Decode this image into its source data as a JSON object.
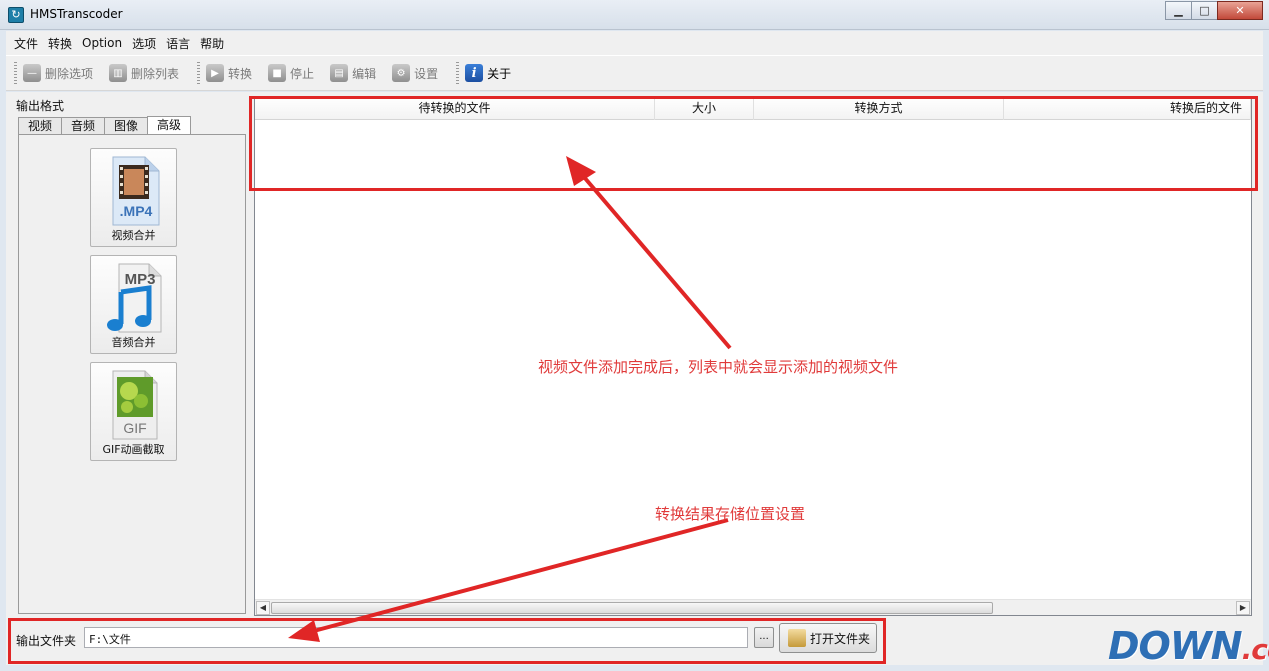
{
  "window": {
    "title": "HMSTranscoder",
    "minimize": "▁",
    "maximize": "□",
    "close": "✕"
  },
  "menu": [
    "文件",
    "转换",
    "Option",
    "选项",
    "语言",
    "帮助"
  ],
  "toolbar": {
    "delete_option": "删除选项",
    "delete_list": "删除列表",
    "convert": "转换",
    "stop": "停止",
    "edit": "编辑",
    "settings": "设置",
    "about": "关于"
  },
  "left": {
    "format_label": "输出格式",
    "tabs": [
      "视频",
      "音频",
      "图像",
      "高级"
    ],
    "selected_tab": "高级",
    "items": [
      {
        "label": "视频合并",
        "thumb": ".MP4"
      },
      {
        "label": "音频合并",
        "thumb": "MP3"
      },
      {
        "label": "GIF动画截取",
        "thumb": "GIF"
      }
    ]
  },
  "list": {
    "columns": [
      "待转换的文件",
      "大小",
      "转换方式",
      "转换后的文件"
    ]
  },
  "output": {
    "label": "输出文件夹",
    "path": "F:\\文件",
    "browse": "...",
    "open_folder": "打开文件夹"
  },
  "annotations": {
    "list_note": "视频文件添加完成后，列表中就会显示添加的视频文件",
    "output_note": "转换结果存储位置设置",
    "color": "#e02626"
  },
  "watermark": {
    "main": "DOWN",
    "suffix": ".cc"
  }
}
